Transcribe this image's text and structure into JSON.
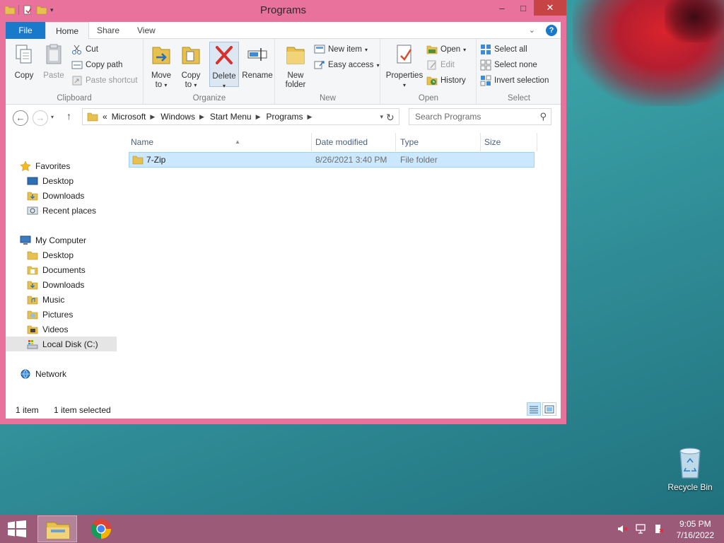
{
  "window": {
    "title": "Programs",
    "controls": {
      "minimize": "–",
      "maximize": "□",
      "close": "✕"
    }
  },
  "ribbon": {
    "tabs": [
      {
        "label": "File"
      },
      {
        "label": "Home"
      },
      {
        "label": "Share"
      },
      {
        "label": "View"
      }
    ],
    "help_label": "?",
    "clipboard": {
      "label": "Clipboard",
      "copy": "Copy",
      "paste": "Paste",
      "cut": "Cut",
      "copy_path": "Copy path",
      "paste_shortcut": "Paste shortcut"
    },
    "organize": {
      "label": "Organize",
      "move_to_line1": "Move",
      "move_to_line2": "to",
      "copy_to_line1": "Copy",
      "copy_to_line2": "to",
      "delete": "Delete",
      "rename": "Rename"
    },
    "new": {
      "label": "New",
      "new_folder_line1": "New",
      "new_folder_line2": "folder",
      "new_item": "New item",
      "easy_access": "Easy access"
    },
    "open": {
      "label": "Open",
      "properties": "Properties",
      "open": "Open",
      "edit": "Edit",
      "history": "History"
    },
    "select": {
      "label": "Select",
      "select_all": "Select all",
      "select_none": "Select none",
      "invert_selection": "Invert selection"
    }
  },
  "address": {
    "overflow": "«",
    "crumbs": [
      "Microsoft",
      "Windows",
      "Start Menu",
      "Programs"
    ],
    "search_placeholder": "Search Programs"
  },
  "nav": {
    "favorites": {
      "label": "Favorites",
      "items": [
        "Desktop",
        "Downloads",
        "Recent places"
      ]
    },
    "computer": {
      "label": "My Computer",
      "items": [
        "Desktop",
        "Documents",
        "Downloads",
        "Music",
        "Pictures",
        "Videos",
        "Local Disk (C:)"
      ]
    },
    "network": {
      "label": "Network"
    }
  },
  "filelist": {
    "columns": [
      "Name",
      "Date modified",
      "Type",
      "Size"
    ],
    "rows": [
      {
        "name": "7-Zip",
        "date": "8/26/2021 3:40 PM",
        "type": "File folder",
        "size": ""
      }
    ]
  },
  "status": {
    "count": "1 item",
    "selected": "1 item selected"
  },
  "desktop": {
    "recycle_bin": "Recycle Bin"
  },
  "taskbar": {
    "time": "9:05 PM",
    "date": "7/16/2022"
  },
  "colors": {
    "window_frame": "#e8729c",
    "file_tab": "#1979ca",
    "selection": "#cce8ff",
    "taskbar": "#9b5a78"
  }
}
